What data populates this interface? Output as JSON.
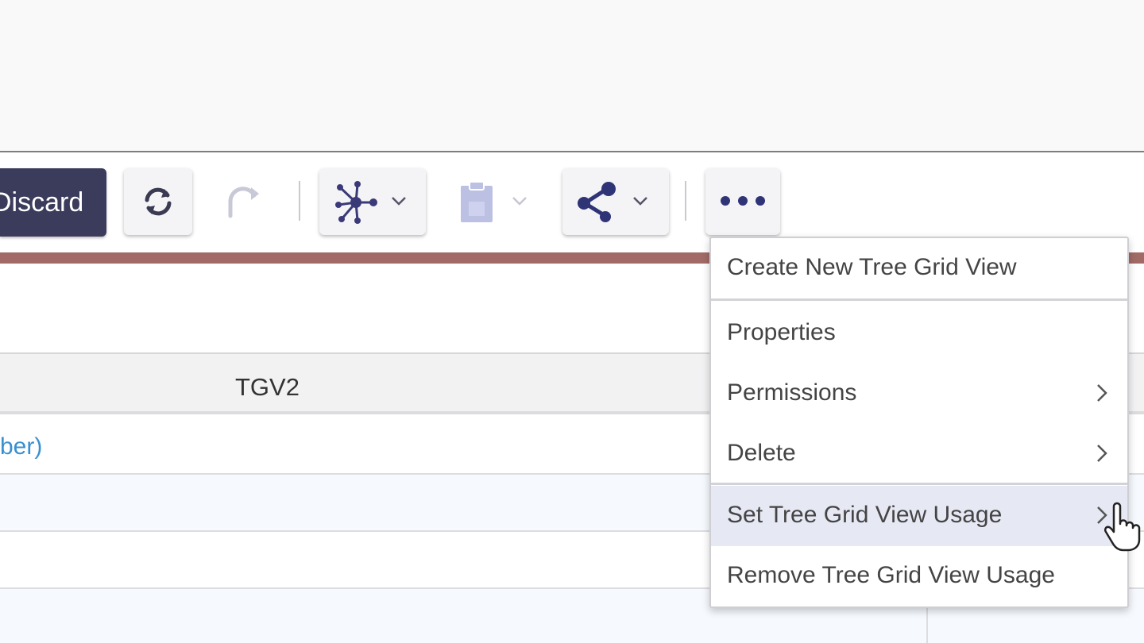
{
  "toolbar": {
    "discard_label": "Discard",
    "buttons": [
      {
        "name": "refresh",
        "icon": "refresh-icon"
      },
      {
        "name": "redo",
        "icon": "redo-icon",
        "disabled": true
      },
      {
        "name": "network",
        "icon": "network-icon",
        "dropdown": true
      },
      {
        "name": "clipboard",
        "icon": "clipboard-icon",
        "dropdown": true,
        "disabled": true
      },
      {
        "name": "share",
        "icon": "share-icon",
        "dropdown": true
      },
      {
        "name": "more",
        "icon": "more-options-icon"
      }
    ],
    "accent_color": "#a26a66",
    "primary_color": "#3b3b5c"
  },
  "grid": {
    "column_header": "TGV2",
    "row_link_text": "ber)"
  },
  "context_menu": {
    "items": [
      {
        "label": "Create New Tree Grid View",
        "submenu": false
      },
      {
        "label": "Properties",
        "submenu": false
      },
      {
        "label": "Permissions",
        "submenu": true
      },
      {
        "label": "Delete",
        "submenu": true
      },
      {
        "label": "Set Tree Grid View Usage",
        "submenu": true,
        "highlighted": true
      },
      {
        "label": "Remove Tree Grid View Usage",
        "submenu": false
      }
    ]
  }
}
